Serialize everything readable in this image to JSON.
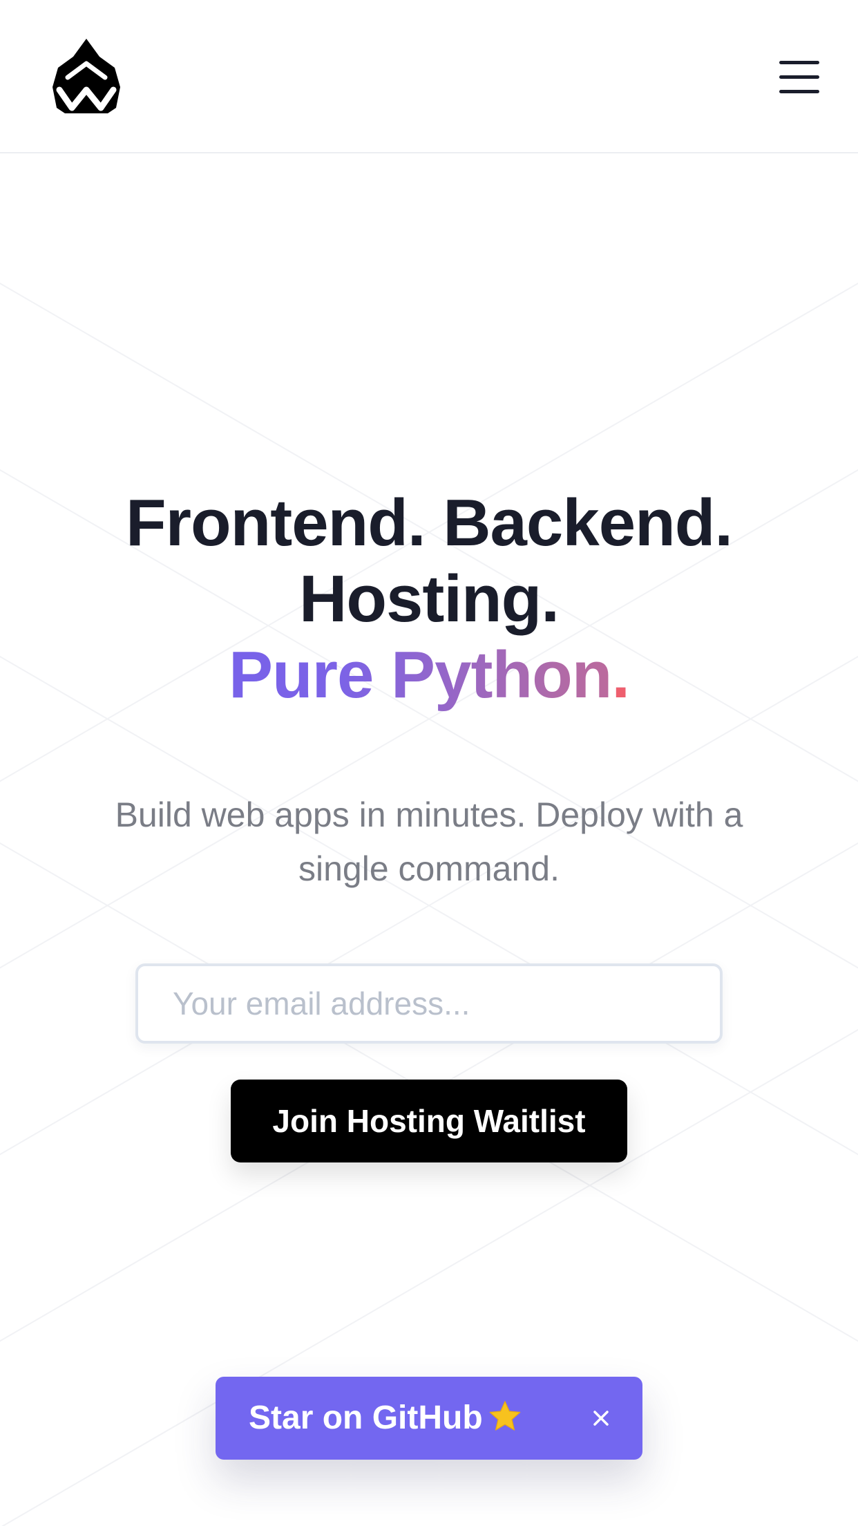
{
  "header": {
    "logo_icon": "reflex-logo-icon",
    "menu_icon": "hamburger-menu-icon"
  },
  "hero": {
    "headline_line1": "Frontend. Backend.",
    "headline_line2": "Hosting.",
    "headline_line3": "Pure Python",
    "headline_line3_dot": ".",
    "subtitle": "Build web apps in minutes. Deploy with a single command.",
    "email_placeholder": "Your email address...",
    "email_value": "",
    "join_button_label": "Join Hosting Waitlist"
  },
  "github_banner": {
    "label": "Star on GitHub",
    "star_icon": "star-icon",
    "close_icon": "close-icon",
    "background_color": "#7367f0"
  },
  "colors": {
    "text_dark": "#1a1d2b",
    "subtitle_gray": "#7a7d86",
    "gradient_start": "#6e5ff0",
    "gradient_end": "#ee5f6e",
    "button_black": "#000000"
  }
}
